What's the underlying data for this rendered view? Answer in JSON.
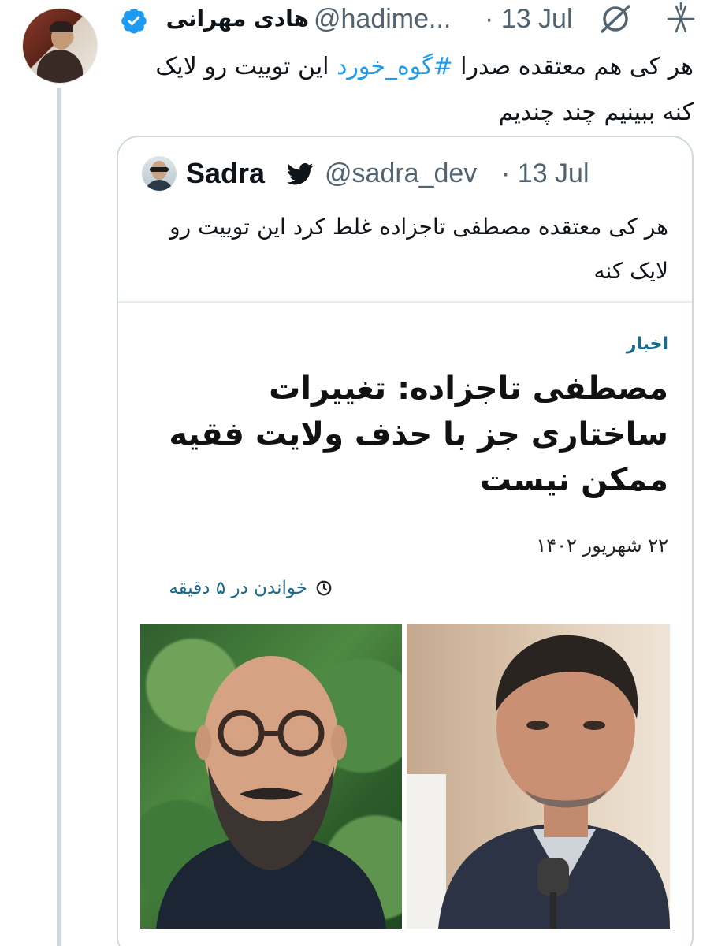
{
  "tweet": {
    "author_name": "هادی مهرانی",
    "handle": "@hadime...",
    "separator": "·",
    "date": "13 Jul",
    "text_before": "هر کی هم معتقده صدرا ",
    "hashtag": "#گوه_خورد",
    "text_after": " این توییت رو لایک کنه ببینیم چند چندیم"
  },
  "quote": {
    "author_name": "Sadra",
    "handle": "@sadra_dev",
    "separator": "·",
    "date": "13 Jul",
    "text": "هر کی معتقده مصطفی تاجزاده غلط کرد این توییت رو لایک کنه"
  },
  "article": {
    "section": "اخبار",
    "title": "مصطفی تاجزاده: تغییرات ساختاری جز با حذف ولایت فقیه ممکن نیست",
    "date": "۲۲ شهریور ۱۴۰۲",
    "read_time": "خواندن در ۵ دقیقه"
  },
  "colors": {
    "link_blue": "#1d9bf0",
    "muted_gray": "#536471",
    "verified_blue": "#1d9bf0",
    "article_accent": "#1b6b8f"
  },
  "icons": {
    "verified": "verified-badge-icon",
    "deleted": "slashed-circle-icon",
    "brand": "x-logo-icon",
    "bird": "twitter-bird-icon",
    "clock": "clock-icon"
  }
}
